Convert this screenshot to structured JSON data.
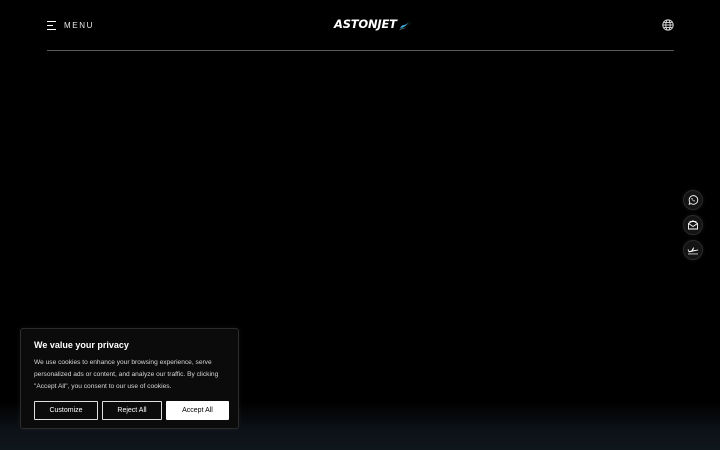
{
  "header": {
    "menu_label": "MENU",
    "logo_text": "ASTONJET"
  },
  "side_actions": [
    {
      "icon": "whatsapp-icon"
    },
    {
      "icon": "mail-icon"
    },
    {
      "icon": "airplane-icon"
    }
  ],
  "cookie_banner": {
    "title": "We value your privacy",
    "body": "We use cookies to enhance your browsing experience, serve personalized ads or content, and analyze our traffic. By clicking \"Accept All\", you consent to our use of cookies.",
    "customize_label": "Customize",
    "reject_label": "Reject All",
    "accept_label": "Accept All"
  },
  "colors": {
    "background": "#000000",
    "header_rule": "#5a5a5a",
    "logo_accent": "#3fb4e6",
    "text": "#ffffff"
  }
}
